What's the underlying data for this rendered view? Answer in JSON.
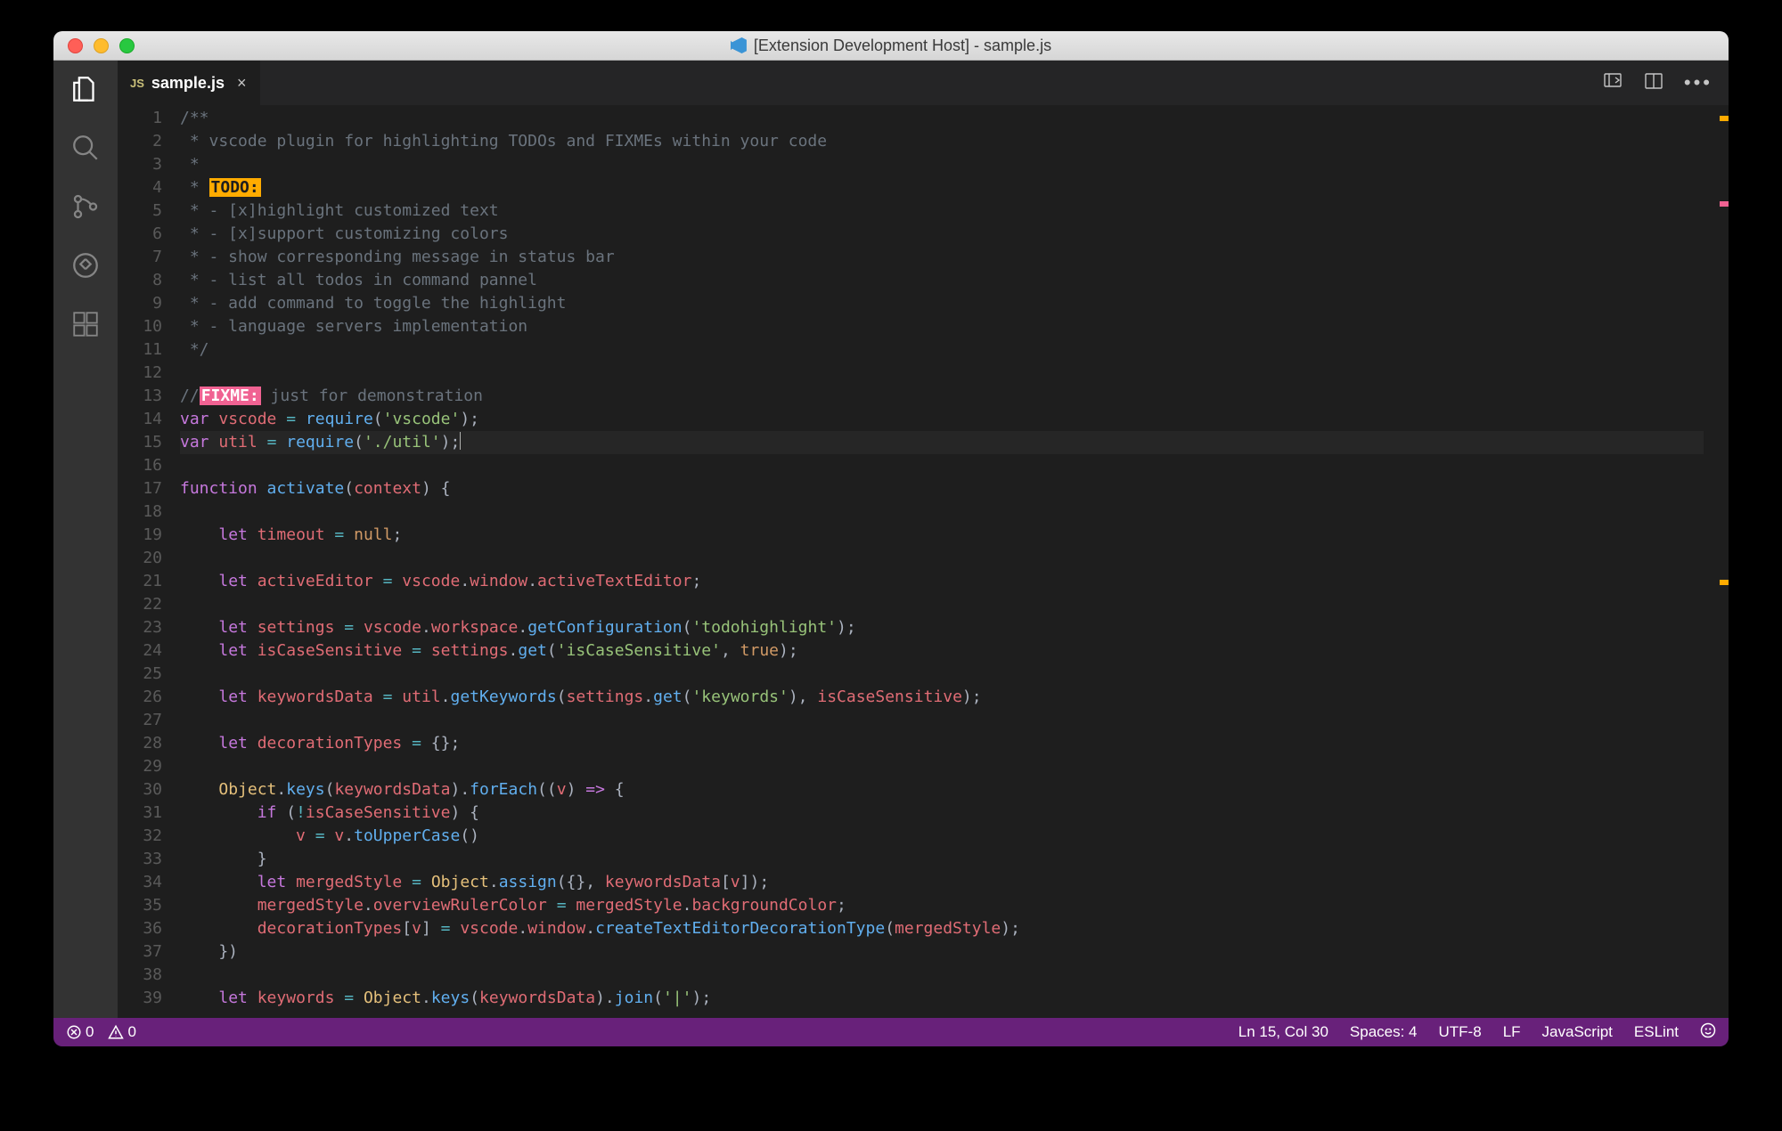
{
  "window": {
    "title": "[Extension Development Host] - sample.js"
  },
  "tab": {
    "lang_badge": "JS",
    "filename": "sample.js"
  },
  "code": {
    "cursor_line": 15,
    "lines": [
      {
        "n": 1,
        "segs": [
          [
            "c-comment",
            "/**"
          ]
        ]
      },
      {
        "n": 2,
        "segs": [
          [
            "c-comment",
            " * vscode plugin for highlighting TODOs and FIXMEs within your code"
          ]
        ]
      },
      {
        "n": 3,
        "segs": [
          [
            "c-comment",
            " * "
          ]
        ]
      },
      {
        "n": 4,
        "segs": [
          [
            "c-comment",
            " * "
          ],
          [
            "hl-todo",
            "TODO:"
          ]
        ]
      },
      {
        "n": 5,
        "segs": [
          [
            "c-comment",
            " * - [x]highlight customized text"
          ]
        ]
      },
      {
        "n": 6,
        "segs": [
          [
            "c-comment",
            " * - [x]support customizing colors"
          ]
        ]
      },
      {
        "n": 7,
        "segs": [
          [
            "c-comment",
            " * - show corresponding message in status bar"
          ]
        ]
      },
      {
        "n": 8,
        "segs": [
          [
            "c-comment",
            " * - list all todos in command pannel"
          ]
        ]
      },
      {
        "n": 9,
        "segs": [
          [
            "c-comment",
            " * - add command to toggle the highlight"
          ]
        ]
      },
      {
        "n": 10,
        "segs": [
          [
            "c-comment",
            " * - language servers implementation"
          ]
        ]
      },
      {
        "n": 11,
        "segs": [
          [
            "c-comment",
            " */"
          ]
        ]
      },
      {
        "n": 12,
        "segs": []
      },
      {
        "n": 13,
        "segs": [
          [
            "c-comment",
            "//"
          ],
          [
            "hl-fixme",
            "FIXME:"
          ],
          [
            "c-comment",
            " just for demonstration"
          ]
        ]
      },
      {
        "n": 14,
        "segs": [
          [
            "c-kw2",
            "var"
          ],
          [
            "c-punc",
            " "
          ],
          [
            "c-var",
            "vscode"
          ],
          [
            "c-punc",
            " "
          ],
          [
            "c-op",
            "="
          ],
          [
            "c-punc",
            " "
          ],
          [
            "c-func",
            "require"
          ],
          [
            "c-punc",
            "("
          ],
          [
            "c-str",
            "'vscode'"
          ],
          [
            "c-punc",
            ");"
          ]
        ]
      },
      {
        "n": 15,
        "segs": [
          [
            "c-kw2",
            "var"
          ],
          [
            "c-punc",
            " "
          ],
          [
            "c-var",
            "util"
          ],
          [
            "c-punc",
            " "
          ],
          [
            "c-op",
            "="
          ],
          [
            "c-punc",
            " "
          ],
          [
            "c-func",
            "require"
          ],
          [
            "c-punc",
            "("
          ],
          [
            "c-str",
            "'./util'"
          ],
          [
            "c-punc",
            ");"
          ],
          [
            "cursor",
            ""
          ]
        ]
      },
      {
        "n": 16,
        "segs": []
      },
      {
        "n": 17,
        "segs": [
          [
            "c-kw2",
            "function"
          ],
          [
            "c-punc",
            " "
          ],
          [
            "c-func",
            "activate"
          ],
          [
            "c-punc",
            "("
          ],
          [
            "c-var",
            "context"
          ],
          [
            "c-punc",
            ") {"
          ]
        ]
      },
      {
        "n": 18,
        "segs": []
      },
      {
        "n": 19,
        "segs": [
          [
            "c-punc",
            "    "
          ],
          [
            "c-kw2",
            "let"
          ],
          [
            "c-punc",
            " "
          ],
          [
            "c-var",
            "timeout"
          ],
          [
            "c-punc",
            " "
          ],
          [
            "c-op",
            "="
          ],
          [
            "c-punc",
            " "
          ],
          [
            "c-varalt",
            "null"
          ],
          [
            "c-punc",
            ";"
          ]
        ]
      },
      {
        "n": 20,
        "segs": []
      },
      {
        "n": 21,
        "segs": [
          [
            "c-punc",
            "    "
          ],
          [
            "c-kw2",
            "let"
          ],
          [
            "c-punc",
            " "
          ],
          [
            "c-var",
            "activeEditor"
          ],
          [
            "c-punc",
            " "
          ],
          [
            "c-op",
            "="
          ],
          [
            "c-punc",
            " "
          ],
          [
            "c-var",
            "vscode"
          ],
          [
            "c-punc",
            "."
          ],
          [
            "c-var",
            "window"
          ],
          [
            "c-punc",
            "."
          ],
          [
            "c-var",
            "activeTextEditor"
          ],
          [
            "c-punc",
            ";"
          ]
        ]
      },
      {
        "n": 22,
        "segs": []
      },
      {
        "n": 23,
        "segs": [
          [
            "c-punc",
            "    "
          ],
          [
            "c-kw2",
            "let"
          ],
          [
            "c-punc",
            " "
          ],
          [
            "c-var",
            "settings"
          ],
          [
            "c-punc",
            " "
          ],
          [
            "c-op",
            "="
          ],
          [
            "c-punc",
            " "
          ],
          [
            "c-var",
            "vscode"
          ],
          [
            "c-punc",
            "."
          ],
          [
            "c-var",
            "workspace"
          ],
          [
            "c-punc",
            "."
          ],
          [
            "c-func",
            "getConfiguration"
          ],
          [
            "c-punc",
            "("
          ],
          [
            "c-str",
            "'todohighlight'"
          ],
          [
            "c-punc",
            ");"
          ]
        ]
      },
      {
        "n": 24,
        "segs": [
          [
            "c-punc",
            "    "
          ],
          [
            "c-kw2",
            "let"
          ],
          [
            "c-punc",
            " "
          ],
          [
            "c-var",
            "isCaseSensitive"
          ],
          [
            "c-punc",
            " "
          ],
          [
            "c-op",
            "="
          ],
          [
            "c-punc",
            " "
          ],
          [
            "c-var",
            "settings"
          ],
          [
            "c-punc",
            "."
          ],
          [
            "c-func",
            "get"
          ],
          [
            "c-punc",
            "("
          ],
          [
            "c-str",
            "'isCaseSensitive'"
          ],
          [
            "c-punc",
            ", "
          ],
          [
            "c-varalt",
            "true"
          ],
          [
            "c-punc",
            ");"
          ]
        ]
      },
      {
        "n": 25,
        "segs": []
      },
      {
        "n": 26,
        "segs": [
          [
            "c-punc",
            "    "
          ],
          [
            "c-kw2",
            "let"
          ],
          [
            "c-punc",
            " "
          ],
          [
            "c-var",
            "keywordsData"
          ],
          [
            "c-punc",
            " "
          ],
          [
            "c-op",
            "="
          ],
          [
            "c-punc",
            " "
          ],
          [
            "c-var",
            "util"
          ],
          [
            "c-punc",
            "."
          ],
          [
            "c-func",
            "getKeywords"
          ],
          [
            "c-punc",
            "("
          ],
          [
            "c-var",
            "settings"
          ],
          [
            "c-punc",
            "."
          ],
          [
            "c-func",
            "get"
          ],
          [
            "c-punc",
            "("
          ],
          [
            "c-str",
            "'keywords'"
          ],
          [
            "c-punc",
            "), "
          ],
          [
            "c-var",
            "isCaseSensitive"
          ],
          [
            "c-punc",
            ");"
          ]
        ]
      },
      {
        "n": 27,
        "segs": []
      },
      {
        "n": 28,
        "segs": [
          [
            "c-punc",
            "    "
          ],
          [
            "c-kw2",
            "let"
          ],
          [
            "c-punc",
            " "
          ],
          [
            "c-var",
            "decorationTypes"
          ],
          [
            "c-punc",
            " "
          ],
          [
            "c-op",
            "="
          ],
          [
            "c-punc",
            " {};"
          ]
        ]
      },
      {
        "n": 29,
        "segs": []
      },
      {
        "n": 30,
        "segs": [
          [
            "c-punc",
            "    "
          ],
          [
            "c-this",
            "Object"
          ],
          [
            "c-punc",
            "."
          ],
          [
            "c-func",
            "keys"
          ],
          [
            "c-punc",
            "("
          ],
          [
            "c-var",
            "keywordsData"
          ],
          [
            "c-punc",
            ")."
          ],
          [
            "c-func",
            "forEach"
          ],
          [
            "c-punc",
            "(("
          ],
          [
            "c-var",
            "v"
          ],
          [
            "c-punc",
            ") "
          ],
          [
            "c-kw2",
            "=>"
          ],
          [
            "c-punc",
            " {"
          ]
        ]
      },
      {
        "n": 31,
        "segs": [
          [
            "c-punc",
            "        "
          ],
          [
            "c-kw2",
            "if"
          ],
          [
            "c-punc",
            " ("
          ],
          [
            "c-op",
            "!"
          ],
          [
            "c-var",
            "isCaseSensitive"
          ],
          [
            "c-punc",
            ") {"
          ]
        ]
      },
      {
        "n": 32,
        "segs": [
          [
            "c-punc",
            "            "
          ],
          [
            "c-var",
            "v"
          ],
          [
            "c-punc",
            " "
          ],
          [
            "c-op",
            "="
          ],
          [
            "c-punc",
            " "
          ],
          [
            "c-var",
            "v"
          ],
          [
            "c-punc",
            "."
          ],
          [
            "c-func",
            "toUpperCase"
          ],
          [
            "c-punc",
            "()"
          ]
        ]
      },
      {
        "n": 33,
        "segs": [
          [
            "c-punc",
            "        }"
          ]
        ]
      },
      {
        "n": 34,
        "segs": [
          [
            "c-punc",
            "        "
          ],
          [
            "c-kw2",
            "let"
          ],
          [
            "c-punc",
            " "
          ],
          [
            "c-var",
            "mergedStyle"
          ],
          [
            "c-punc",
            " "
          ],
          [
            "c-op",
            "="
          ],
          [
            "c-punc",
            " "
          ],
          [
            "c-this",
            "Object"
          ],
          [
            "c-punc",
            "."
          ],
          [
            "c-func",
            "assign"
          ],
          [
            "c-punc",
            "({}, "
          ],
          [
            "c-var",
            "keywordsData"
          ],
          [
            "c-punc",
            "["
          ],
          [
            "c-var",
            "v"
          ],
          [
            "c-punc",
            "]);"
          ]
        ]
      },
      {
        "n": 35,
        "segs": [
          [
            "c-punc",
            "        "
          ],
          [
            "c-var",
            "mergedStyle"
          ],
          [
            "c-punc",
            "."
          ],
          [
            "c-var",
            "overviewRulerColor"
          ],
          [
            "c-punc",
            " "
          ],
          [
            "c-op",
            "="
          ],
          [
            "c-punc",
            " "
          ],
          [
            "c-var",
            "mergedStyle"
          ],
          [
            "c-punc",
            "."
          ],
          [
            "c-var",
            "backgroundColor"
          ],
          [
            "c-punc",
            ";"
          ]
        ]
      },
      {
        "n": 36,
        "segs": [
          [
            "c-punc",
            "        "
          ],
          [
            "c-var",
            "decorationTypes"
          ],
          [
            "c-punc",
            "["
          ],
          [
            "c-var",
            "v"
          ],
          [
            "c-punc",
            "] "
          ],
          [
            "c-op",
            "="
          ],
          [
            "c-punc",
            " "
          ],
          [
            "c-var",
            "vscode"
          ],
          [
            "c-punc",
            "."
          ],
          [
            "c-var",
            "window"
          ],
          [
            "c-punc",
            "."
          ],
          [
            "c-func",
            "createTextEditorDecorationType"
          ],
          [
            "c-punc",
            "("
          ],
          [
            "c-var",
            "mergedStyle"
          ],
          [
            "c-punc",
            ");"
          ]
        ]
      },
      {
        "n": 37,
        "segs": [
          [
            "c-punc",
            "    })"
          ]
        ]
      },
      {
        "n": 38,
        "segs": []
      },
      {
        "n": 39,
        "segs": [
          [
            "c-punc",
            "    "
          ],
          [
            "c-kw2",
            "let"
          ],
          [
            "c-punc",
            " "
          ],
          [
            "c-var",
            "keywords"
          ],
          [
            "c-punc",
            " "
          ],
          [
            "c-op",
            "="
          ],
          [
            "c-punc",
            " "
          ],
          [
            "c-this",
            "Object"
          ],
          [
            "c-punc",
            "."
          ],
          [
            "c-func",
            "keys"
          ],
          [
            "c-punc",
            "("
          ],
          [
            "c-var",
            "keywordsData"
          ],
          [
            "c-punc",
            ")."
          ],
          [
            "c-func",
            "join"
          ],
          [
            "c-punc",
            "("
          ],
          [
            "c-str",
            "'|'"
          ],
          [
            "c-punc",
            ");"
          ]
        ]
      }
    ]
  },
  "ruler": [
    {
      "top_pct": 1.2,
      "color": "#ffab00"
    },
    {
      "top_pct": 10.5,
      "color": "#f06292"
    },
    {
      "top_pct": 52,
      "color": "#ffab00"
    }
  ],
  "status": {
    "errors": "0",
    "warnings": "0",
    "cursor": "Ln 15, Col 30",
    "spaces": "Spaces: 4",
    "encoding": "UTF-8",
    "eol": "LF",
    "language": "JavaScript",
    "linter": "ESLint"
  }
}
